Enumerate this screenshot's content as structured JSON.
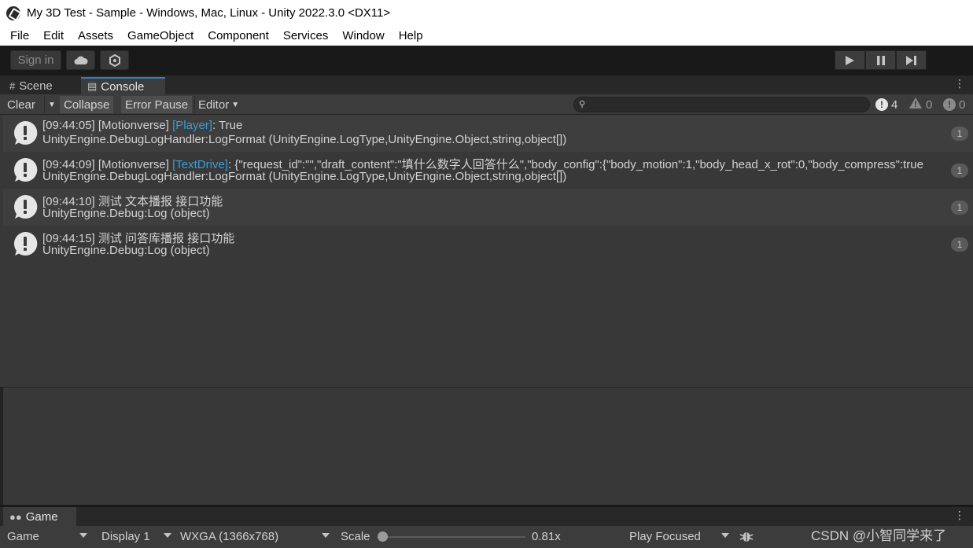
{
  "window": {
    "title": "My 3D Test - Sample - Windows, Mac, Linux - Unity 2022.3.0 <DX11>"
  },
  "menu": [
    "File",
    "Edit",
    "Assets",
    "GameObject",
    "Component",
    "Services",
    "Window",
    "Help"
  ],
  "toolbar": {
    "sign_in_label": "Sign in",
    "cloud_icon": "cloud-icon",
    "collab_icon": "collab-icon",
    "play_icon": "play-icon",
    "pause_icon": "pause-icon",
    "step_icon": "step-icon"
  },
  "tabs": {
    "scene_label": "Scene",
    "console_label": "Console",
    "game_label": "Game"
  },
  "console": {
    "clear_label": "Clear",
    "collapse_label": "Collapse",
    "error_pause_label": "Error Pause",
    "editor_label": "Editor",
    "search_value": "",
    "log_count": "4",
    "warning_count": "0",
    "error_count": "0"
  },
  "logs": [
    {
      "prefix": "[09:44:05] [Motionverse] ",
      "tag": "[Player]",
      "message": ": True",
      "stack": "UnityEngine.DebugLogHandler:LogFormat (UnityEngine.LogType,UnityEngine.Object,string,object[])",
      "count": "1"
    },
    {
      "prefix": "[09:44:09] [Motionverse] ",
      "tag": "[TextDrive]",
      "message": ": {\"request_id\":\"\",\"draft_content\":\"填什么数字人回答什么\",\"body_config\":{\"body_motion\":1,\"body_head_x_rot\":0,\"body_compress\":true",
      "stack": "UnityEngine.DebugLogHandler:LogFormat (UnityEngine.LogType,UnityEngine.Object,string,object[])",
      "count": "1"
    },
    {
      "prefix": "[09:44:10] 测试 文本播报 接口功能",
      "tag": "",
      "message": "",
      "stack": "UnityEngine.Debug:Log (object)",
      "count": "1"
    },
    {
      "prefix": "[09:44:15] 测试 问答库播报 接口功能",
      "tag": "",
      "message": "",
      "stack": "UnityEngine.Debug:Log (object)",
      "count": "1"
    }
  ],
  "game_toolbar": {
    "view_label": "Game",
    "display_label": "Display 1",
    "resolution_label": "WXGA (1366x768)",
    "scale_label": "Scale",
    "scale_value": "0.81x",
    "scale_fraction": 0.0,
    "play_mode_label": "Play Focused",
    "bug_icon": "bug-icon"
  },
  "watermark": "CSDN @小智同学来了"
}
